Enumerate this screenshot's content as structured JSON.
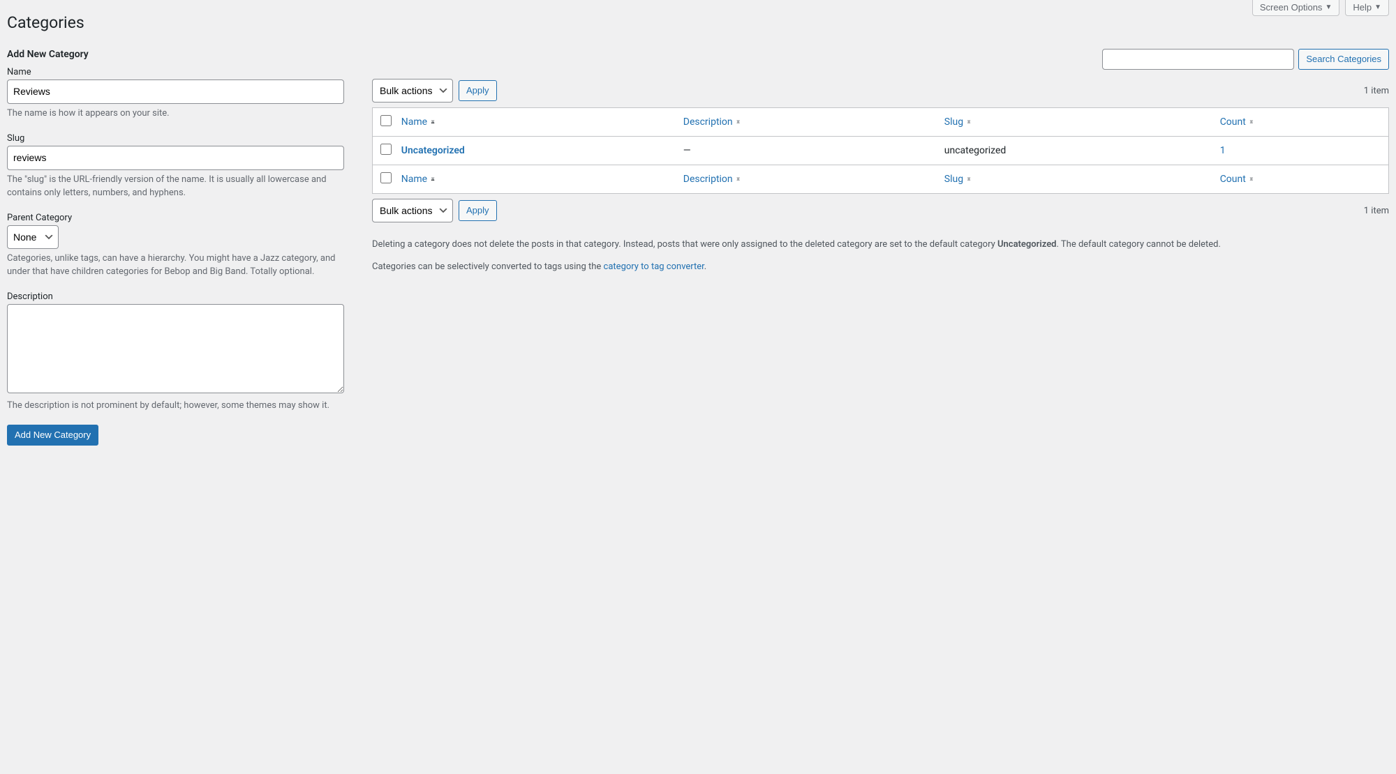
{
  "top_buttons": {
    "screen_options": "Screen Options",
    "help": "Help"
  },
  "page_title": "Categories",
  "search": {
    "button": "Search Categories"
  },
  "form": {
    "heading": "Add New Category",
    "name_label": "Name",
    "name_value": "Reviews",
    "name_help": "The name is how it appears on your site.",
    "slug_label": "Slug",
    "slug_value": "reviews",
    "slug_help": "The \"slug\" is the URL-friendly version of the name. It is usually all lowercase and contains only letters, numbers, and hyphens.",
    "parent_label": "Parent Category",
    "parent_value": "None",
    "parent_help": "Categories, unlike tags, can have a hierarchy. You might have a Jazz category, and under that have children categories for Bebop and Big Band. Totally optional.",
    "description_label": "Description",
    "description_help": "The description is not prominent by default; however, some themes may show it.",
    "submit": "Add New Category"
  },
  "bulk": {
    "select_label": "Bulk actions",
    "apply": "Apply"
  },
  "pagination": "1 item",
  "table": {
    "columns": {
      "name": "Name",
      "description": "Description",
      "slug": "Slug",
      "count": "Count"
    },
    "rows": [
      {
        "name": "Uncategorized",
        "description": "—",
        "slug": "uncategorized",
        "count": "1"
      }
    ]
  },
  "notes": {
    "delete_text_1": "Deleting a category does not delete the posts in that category. Instead, posts that were only assigned to the deleted category are set to the default category ",
    "delete_default": "Uncategorized",
    "delete_text_2": ". The default category cannot be deleted.",
    "convert_text_1": "Categories can be selectively converted to tags using the ",
    "convert_link": "category to tag converter",
    "convert_text_2": "."
  }
}
